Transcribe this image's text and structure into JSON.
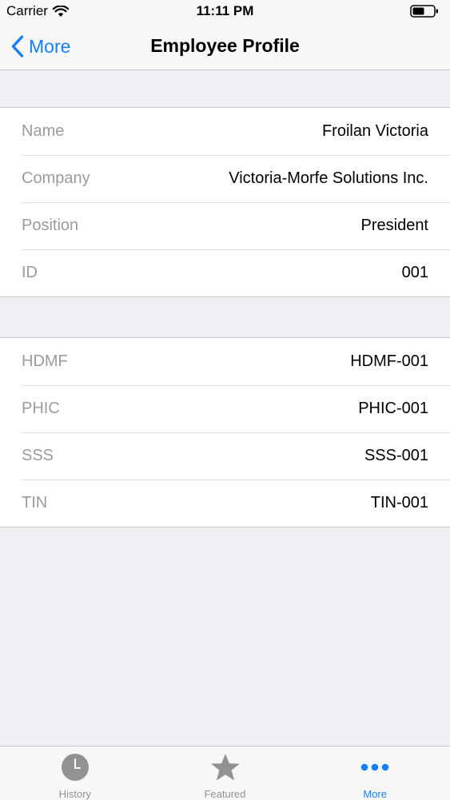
{
  "status_bar": {
    "carrier": "Carrier",
    "time": "11:11 PM"
  },
  "nav": {
    "back_label": "More",
    "title": "Employee Profile"
  },
  "profile": [
    {
      "label": "Name",
      "value": "Froilan Victoria"
    },
    {
      "label": "Company",
      "value": "Victoria-Morfe Solutions Inc."
    },
    {
      "label": "Position",
      "value": "President"
    },
    {
      "label": "ID",
      "value": "001"
    }
  ],
  "ids": [
    {
      "label": "HDMF",
      "value": "HDMF-001"
    },
    {
      "label": "PHIC",
      "value": "PHIC-001"
    },
    {
      "label": "SSS",
      "value": "SSS-001"
    },
    {
      "label": "TIN",
      "value": "TIN-001"
    }
  ],
  "tabs": [
    {
      "label": "History",
      "icon": "clock-icon"
    },
    {
      "label": "Featured",
      "icon": "star-icon"
    },
    {
      "label": "More",
      "icon": "more-icon"
    }
  ],
  "colors": {
    "accent": "#147efb",
    "background": "#efeff4",
    "inactive": "#929292"
  }
}
